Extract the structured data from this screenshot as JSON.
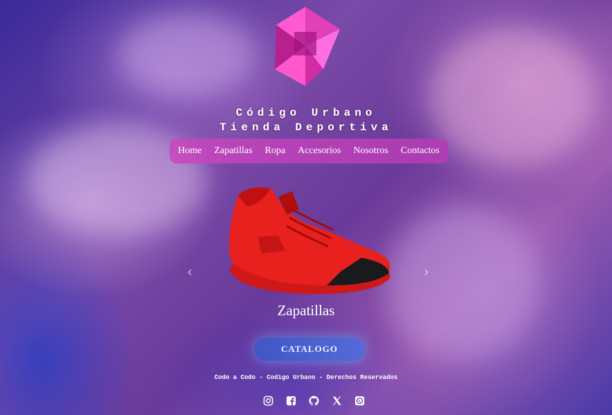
{
  "brand": {
    "line1": "Código Urbano",
    "line2": "Tienda Deportiva",
    "logo_icon": "pinwheel-star-logo"
  },
  "nav": {
    "items": [
      "Home",
      "Zapatillas",
      "Ropa",
      "Accesorios",
      "Nosotros",
      "Contactos"
    ]
  },
  "carousel": {
    "caption": "Zapatillas",
    "prev_icon": "chevron-left-icon",
    "next_icon": "chevron-right-icon",
    "image": "red-sneaker"
  },
  "cta": {
    "label": "CATALOGO"
  },
  "footer": {
    "text": "Codo a Codo - Codigo Urbano - Derechos Reservados"
  },
  "socials": [
    "instagram-icon",
    "facebook-icon",
    "github-icon",
    "x-icon",
    "whatsapp-icon"
  ],
  "colors": {
    "accent": "#c84cbe",
    "button": "#4a6cd4",
    "shoe": "#e8201e"
  }
}
